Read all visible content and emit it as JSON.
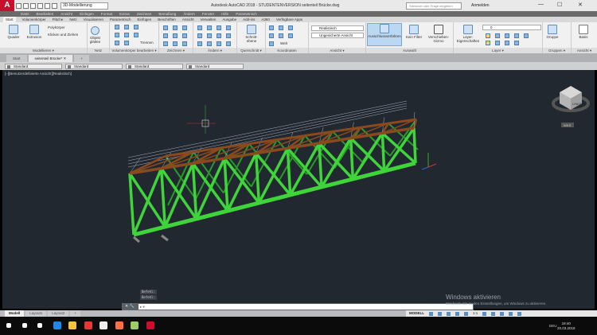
{
  "titlebar": {
    "app_logo": "A",
    "workspace": "3D-Modellierung",
    "title": "Autodesk AutoCAD 2018 - STUDENTENVERSION    seitenteil Brücke.dwg",
    "search_placeholder": "Stichwort oder Frage eingeben",
    "login": "Anmelden",
    "minimize": "—",
    "maximize": "☐",
    "close": "✕"
  },
  "menubar": [
    "Datei",
    "Bearbeiten",
    "Ansicht",
    "Einfügen",
    "Format",
    "Extras",
    "Zeichnen",
    "Bemaßung",
    "Ändern",
    "Fenster",
    "Hilfe",
    "Parametrisch"
  ],
  "ribbon_tabs": [
    "Start",
    "Volumenkörper",
    "Fläche",
    "Netz",
    "Visualisieren",
    "Parametrisch",
    "Einfügen",
    "Beschriften",
    "Ansicht",
    "Verwalten",
    "Ausgabe",
    "Add-ins",
    "A360",
    "Verfügbare Apps"
  ],
  "ribbon": {
    "modellieren": {
      "label": "Modellieren ▾",
      "quader": "Quader",
      "extrusion": "Extrusion",
      "polykoerper": "Polykörper",
      "klicken": "Klicken und Ziehen"
    },
    "netz": {
      "label": "Netz",
      "objekt": "Objekt glätten"
    },
    "volumen": {
      "label": "Volumenkörper bearbeiten ▾",
      "trennen": "Trennen"
    },
    "zeichnen": {
      "label": "Zeichnen ▾"
    },
    "aendern": {
      "label": "Ändern ▾"
    },
    "querschnitt": {
      "label": "Querschnitt ▾",
      "schnitt": "Schnitt-ebene"
    },
    "koordinaten": {
      "label": "Koordinaten",
      "welt": "Welt"
    },
    "ansicht": {
      "label": "Ansicht ▾",
      "style": "Realistisch",
      "view": "Ungesicherte Ansicht"
    },
    "auswahl": {
      "label": "Auswahl",
      "ausschluss": "Ausschlussverfahren",
      "filter": "Kein Filter",
      "gizmo": "Verschieben-Gizmo"
    },
    "layer": {
      "label": "Layer ▾",
      "eigenschaften": "Layer-Eigenschaften",
      "current": "0"
    },
    "gruppen": {
      "label": "Gruppen ▾",
      "gruppe": "Gruppe"
    },
    "ansicht2": {
      "label": "Ansicht ▾",
      "basis": "Basis"
    }
  },
  "file_tabs": [
    {
      "label": "Start",
      "active": false
    },
    {
      "label": "seitenteil Brücke* ✕",
      "active": true
    },
    {
      "label": "+",
      "active": false
    }
  ],
  "toolbar": [
    "Standard",
    "Standard",
    "Standard",
    "Standard"
  ],
  "viewport": {
    "label": "[–][Benutzerdefinierte Ansicht][Realistisch]",
    "viewcube_face": "LINKS",
    "wcs": "WKS",
    "background": "#212830",
    "model_color": "#3ed43a",
    "beam_color": "#8a4a1e"
  },
  "command": {
    "history": [
      "Befehl:",
      "Befehl:"
    ],
    "prompt": "▸ ▾",
    "buttons": "✕ 🔧"
  },
  "watermark": {
    "line1": "Windows aktivieren",
    "line2": "Wechseln Sie zu den Einstellungen, um Windows zu aktivieren."
  },
  "layout_tabs": [
    {
      "label": "Modell",
      "active": true
    },
    {
      "label": "Layout1",
      "active": false
    },
    {
      "label": "Layout2",
      "active": false
    },
    {
      "label": "+",
      "active": false
    }
  ],
  "statusbar": {
    "mode": "MODELL",
    "scale": "1:1"
  },
  "taskbar": {
    "time": "18:40",
    "date": "20.03.2018",
    "lang": "DEU",
    "apps": [
      "windows-start-icon",
      "search-icon",
      "task-view-icon",
      "edge-icon",
      "file-explorer-icon",
      "chrome-icon",
      "mail-icon",
      "firefox-icon",
      "app-icon",
      "autocad-icon"
    ]
  }
}
